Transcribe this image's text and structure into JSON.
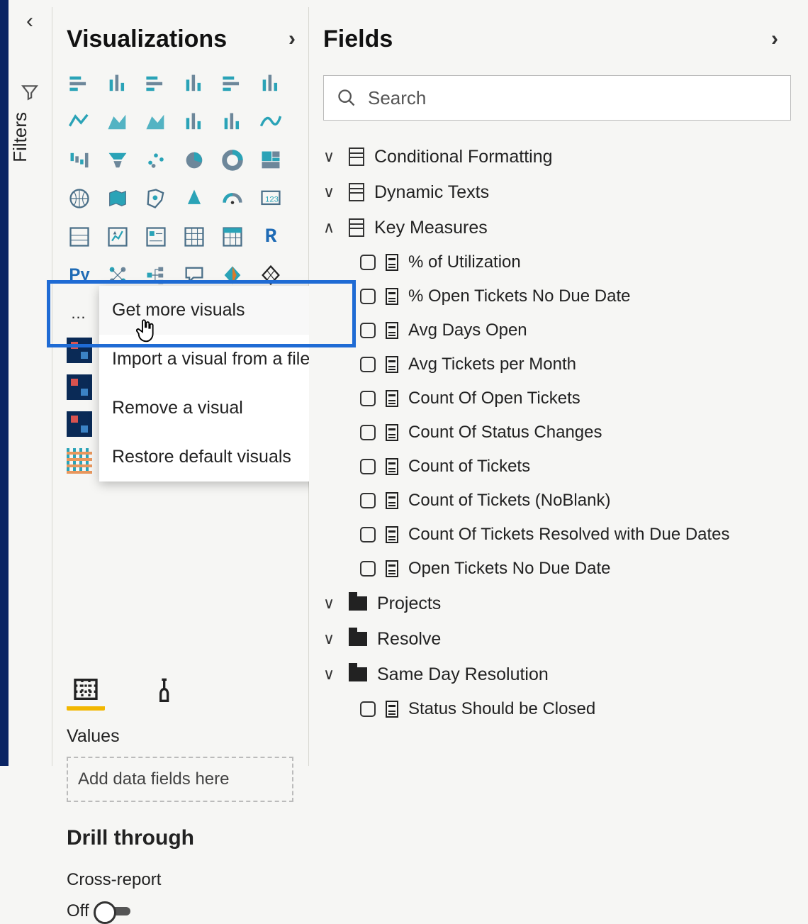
{
  "filters": {
    "label": "Filters"
  },
  "visualizations": {
    "title": "Visualizations",
    "more_menu": {
      "get_more": "Get more visuals",
      "import": "Import a visual from a file",
      "remove": "Remove a visual",
      "restore": "Restore default visuals"
    },
    "values_label": "Values",
    "dropzone": "Add data fields here",
    "drill_heading": "Drill through",
    "cross_label": "Cross-report",
    "cross_state": "Off",
    "gallery_icons": [
      "stacked-bar",
      "stacked-column",
      "clustered-bar",
      "clustered-column",
      "100-stacked-bar",
      "100-stacked-column",
      "line",
      "area",
      "stacked-area",
      "line-stacked-column",
      "line-clustered-column",
      "ribbon",
      "waterfall",
      "funnel",
      "scatter",
      "pie",
      "donut",
      "treemap",
      "map",
      "filled-map",
      "shape-map",
      "azure-map",
      "gauge",
      "card",
      "multirow-card",
      "kpi",
      "slicer",
      "table",
      "matrix",
      "r-visual",
      "py-visual",
      "key-influencers",
      "decomposition-tree",
      "qa",
      "power-apps",
      "paginated"
    ]
  },
  "fields": {
    "title": "Fields",
    "search_placeholder": "Search",
    "tables": [
      {
        "name": "Conditional Formatting",
        "expanded": false,
        "type": "table"
      },
      {
        "name": "Dynamic Texts",
        "expanded": false,
        "type": "table"
      },
      {
        "name": "Key Measures",
        "expanded": true,
        "type": "table",
        "measures": [
          "% of Utilization",
          "% Open Tickets No Due Date",
          "Avg Days Open",
          "Avg Tickets per Month",
          "Count Of Open Tickets",
          "Count Of Status Changes",
          "Count of Tickets",
          "Count of Tickets (NoBlank)",
          "Count Of Tickets Resolved with Due Dates",
          "Open Tickets No Due Date"
        ]
      },
      {
        "name": "Projects",
        "expanded": false,
        "type": "folder"
      },
      {
        "name": "Resolve",
        "expanded": false,
        "type": "folder"
      },
      {
        "name": "Same Day Resolution",
        "expanded": false,
        "type": "folder",
        "measures": [
          "Status Should be Closed"
        ],
        "child_expanded": true
      }
    ]
  }
}
